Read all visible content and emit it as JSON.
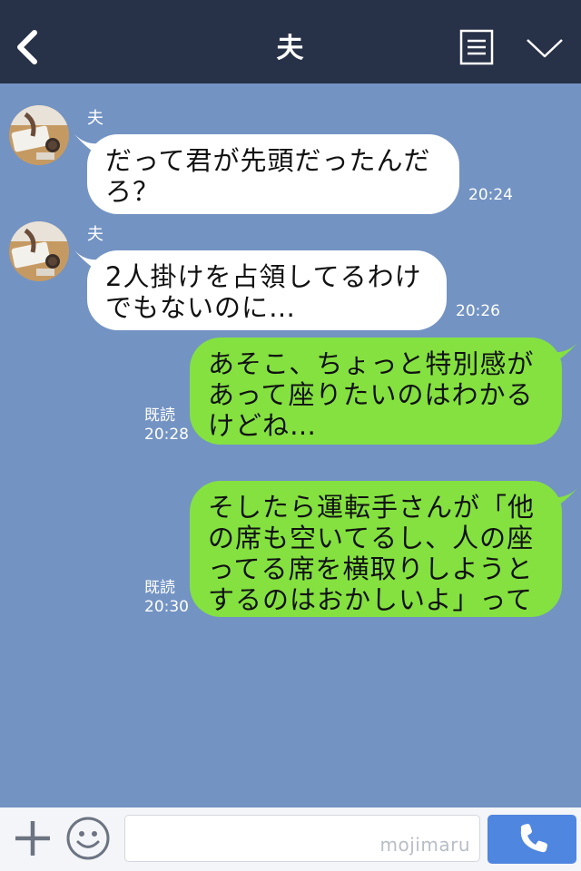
{
  "header": {
    "title": "夫",
    "back_icon": "chevron-left-icon",
    "menu_icon": "document-list-icon",
    "dropdown_icon": "chevron-down-icon",
    "background_color": "#273147"
  },
  "chat": {
    "background_color": "#7393c3",
    "messages": [
      {
        "direction": "incoming",
        "sender": "夫",
        "text": "だって君が先頭だったんだ\nろ？",
        "time": "20:24"
      },
      {
        "direction": "incoming",
        "sender": "夫",
        "text": "2人掛けを占領してるわけ\nでもないのに…",
        "time": "20:26"
      },
      {
        "direction": "outgoing",
        "text": "あそこ、ちょっと特別感が\nあって座りたいのはわかる\nけどね…",
        "read": "既読",
        "time": "20:28"
      },
      {
        "direction": "outgoing",
        "text": "そしたら運転手さんが「他\nの席も空いてるし、人の座\nってる席を横取りしようと\nするのはおかしいよ」って",
        "read": "既読",
        "time": "20:30"
      }
    ],
    "incoming_bubble_color": "#ffffff",
    "outgoing_bubble_color": "#84e140"
  },
  "inputbar": {
    "plus_icon": "plus-icon",
    "emoji_icon": "smiley-icon",
    "input_value": "",
    "watermark": "mojimaru",
    "call_icon": "phone-icon",
    "call_button_color": "#4f86e0"
  }
}
